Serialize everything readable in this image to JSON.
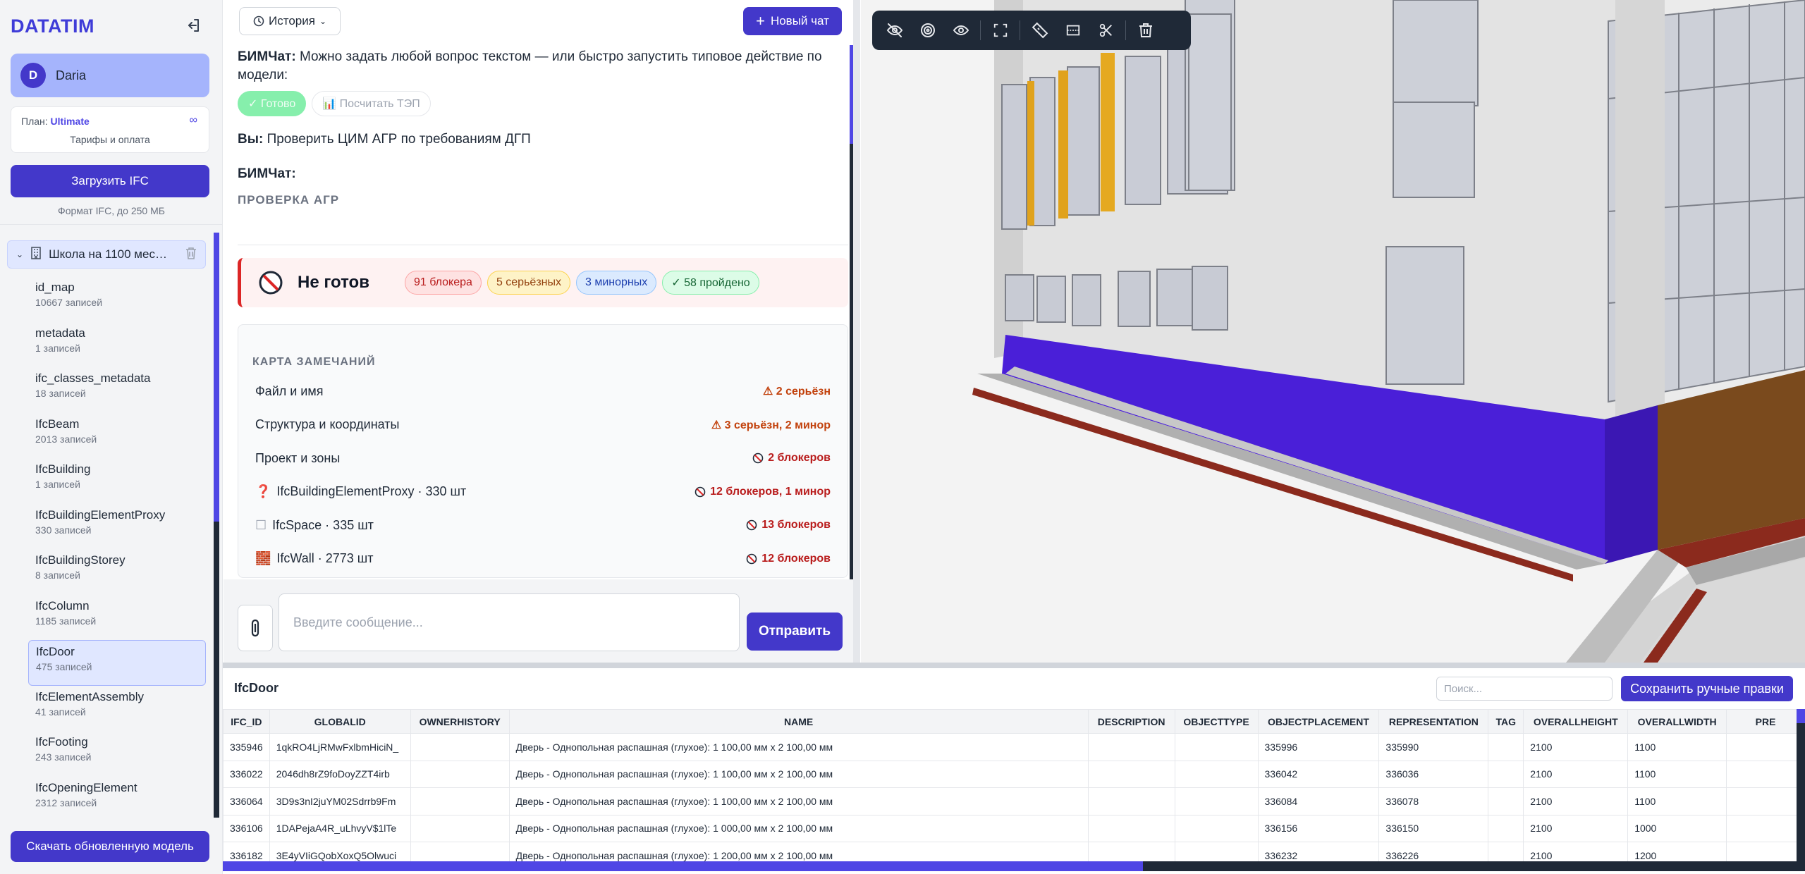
{
  "app": {
    "brand": "DATATIM"
  },
  "user": {
    "initial": "D",
    "name": "Daria"
  },
  "plan": {
    "prefix": "План:",
    "name": "Ultimate",
    "infinity": "∞",
    "billing_link": "Тарифы и оплата"
  },
  "sidebar": {
    "upload_label": "Загрузить IFC",
    "format_hint": "Формат IFC, до 250 МБ",
    "model_name": "Школа на 1100 мес…",
    "tables": [
      {
        "name": "id_map",
        "count": "10667 записей"
      },
      {
        "name": "metadata",
        "count": "1 записей"
      },
      {
        "name": "ifc_classes_metadata",
        "count": "18 записей"
      },
      {
        "name": "IfcBeam",
        "count": "2013 записей"
      },
      {
        "name": "IfcBuilding",
        "count": "1 записей"
      },
      {
        "name": "IfcBuildingElementProxy",
        "count": "330 записей"
      },
      {
        "name": "IfcBuildingStorey",
        "count": "8 записей"
      },
      {
        "name": "IfcColumn",
        "count": "1185 записей"
      },
      {
        "name": "IfcDoor",
        "count": "475 записей",
        "active": true
      },
      {
        "name": "IfcElementAssembly",
        "count": "41 записей"
      },
      {
        "name": "IfcFooting",
        "count": "243 записей"
      },
      {
        "name": "IfcOpeningElement",
        "count": "2312 записей"
      }
    ],
    "download_label": "Скачать обновленную модель"
  },
  "chat": {
    "history_label": "История",
    "new_chat_label": "Новый чат",
    "intro_author": "БИМЧат:",
    "intro_text": "Можно задать любой вопрос текстом — или быстро запустить типовое действие по модели:",
    "chip_done": "✓ Готово",
    "chip_tep": "📊 Посчитать ТЭП",
    "user_author": "Вы:",
    "user_text": "Проверить ЦИМ АГР по требованиям ДГП",
    "bot_author": "БИМЧат:",
    "section_caption": "ПРОВЕРКА АГР",
    "status_title": "Не готов",
    "badges": {
      "blockers": "91 блокера",
      "serious": "5 серьёзных",
      "minor": "3 минорных",
      "passed": "✓ 58 пройдено"
    },
    "issues_caption": "КАРТА ЗАМЕЧАНИЙ",
    "issues": [
      {
        "icon": "",
        "name": "Файл и имя",
        "summary": "⚠ 2 серьёзн",
        "severity": "serious"
      },
      {
        "icon": "",
        "name": "Структура и координаты",
        "summary": "⚠ 3 серьёзн, 2 минор",
        "severity": "serious"
      },
      {
        "icon": "",
        "name": "Проект и зоны",
        "summary": "2 блокеров",
        "severity": "block"
      },
      {
        "icon": "❓",
        "name": "IfcBuildingElementProxy · 330 шт",
        "summary": "12 блокеров, 1 минор",
        "severity": "block"
      },
      {
        "icon": "☐",
        "name": "IfcSpace · 335 шт",
        "summary": "13 блокеров",
        "severity": "block"
      },
      {
        "icon": "🧱",
        "name": "IfcWall · 2773 шт",
        "summary": "12 блокеров",
        "severity": "block"
      }
    ],
    "input_placeholder": "Введите сообщение...",
    "send_label": "Отправить"
  },
  "viewer": {
    "tools": [
      "eye-off-icon",
      "target-icon",
      "eye-icon",
      "fullscreen-icon",
      "ruler-icon",
      "section-box-icon",
      "scissors-icon",
      "trash-icon"
    ]
  },
  "datatable": {
    "title": "IfcDoor",
    "search_placeholder": "Поиск...",
    "save_label": "Сохранить ручные правки",
    "columns": [
      "IFC_ID",
      "GLOBALID",
      "OWNERHISTORY",
      "NAME",
      "DESCRIPTION",
      "OBJECTTYPE",
      "OBJECTPLACEMENT",
      "REPRESENTATION",
      "TAG",
      "OVERALLHEIGHT",
      "OVERALLWIDTH",
      "PRE"
    ],
    "rows": [
      [
        "335946",
        "1qkRO4LjRMwFxlbmHiciN_",
        "",
        "Дверь - Однопольная распашная (глухое): 1 100,00 мм x 2 100,00 мм",
        "",
        "",
        "335996",
        "335990",
        "",
        "2100",
        "1100",
        ""
      ],
      [
        "336022",
        "2046dh8rZ9foDoyZZT4irb",
        "",
        "Дверь - Однопольная распашная (глухое): 1 100,00 мм x 2 100,00 мм",
        "",
        "",
        "336042",
        "336036",
        "",
        "2100",
        "1100",
        ""
      ],
      [
        "336064",
        "3D9s3nI2juYM02Sdrrb9Fm",
        "",
        "Дверь - Однопольная распашная (глухое): 1 100,00 мм x 2 100,00 мм",
        "",
        "",
        "336084",
        "336078",
        "",
        "2100",
        "1100",
        ""
      ],
      [
        "336106",
        "1DAPejaA4R_uLhvyV$1lTe",
        "",
        "Дверь - Однопольная распашная (глухое): 1 000,00 мм x 2 100,00 мм",
        "",
        "",
        "336156",
        "336150",
        "",
        "2100",
        "1000",
        ""
      ],
      [
        "336182",
        "3E4yVIiGQobXoxQ5Olwuci",
        "",
        "Дверь - Однопольная распашная (глухое): 1 200,00 мм x 2 100,00 мм",
        "",
        "",
        "336232",
        "336226",
        "",
        "2100",
        "1200",
        ""
      ]
    ]
  }
}
